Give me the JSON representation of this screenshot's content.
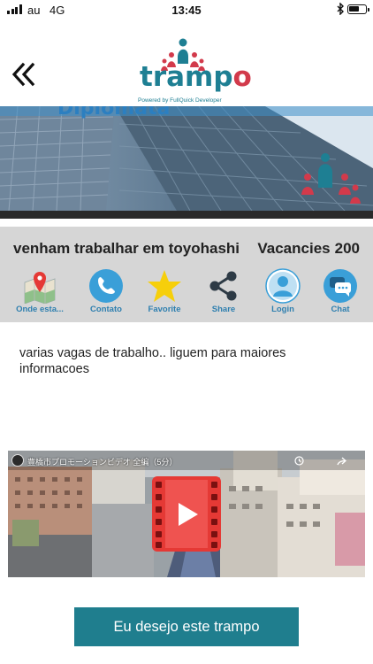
{
  "status_bar": {
    "carrier": "au",
    "network": "4G",
    "time": "13:45"
  },
  "header": {
    "logo": {
      "word_teal": "tramp",
      "word_red": "o",
      "tagline": "Powered by FullQuick Developer"
    },
    "back_icon": "double-chevron-left-icon"
  },
  "banner": {
    "text": "Diplomata"
  },
  "job": {
    "title": "venham trabalhar em toyohashi",
    "vacancies_label": "Vacancies",
    "vacancies_count": "200"
  },
  "actions": [
    {
      "label": "Onde esta...",
      "icon": "map-pin-icon"
    },
    {
      "label": "Contato",
      "icon": "phone-icon"
    },
    {
      "label": "Favorite",
      "icon": "star-icon"
    },
    {
      "label": "Share",
      "icon": "share-icon"
    },
    {
      "label": "Login",
      "icon": "user-icon"
    },
    {
      "label": "Chat",
      "icon": "chat-icon"
    }
  ],
  "description": "varias vagas de trabalho.. liguem para maiores informacoes",
  "video": {
    "title": "豊橋市プロモーションビデオ 全編（5分）",
    "play_icon": "play-icon"
  },
  "cta": {
    "label": "Eu desejo este trampo"
  },
  "colors": {
    "brand_teal": "#1e7f93",
    "brand_red": "#d23a4b",
    "cta_bg": "#1f7e8e",
    "action_label": "#2e7faf",
    "info_bg": "#d6d6d6"
  }
}
